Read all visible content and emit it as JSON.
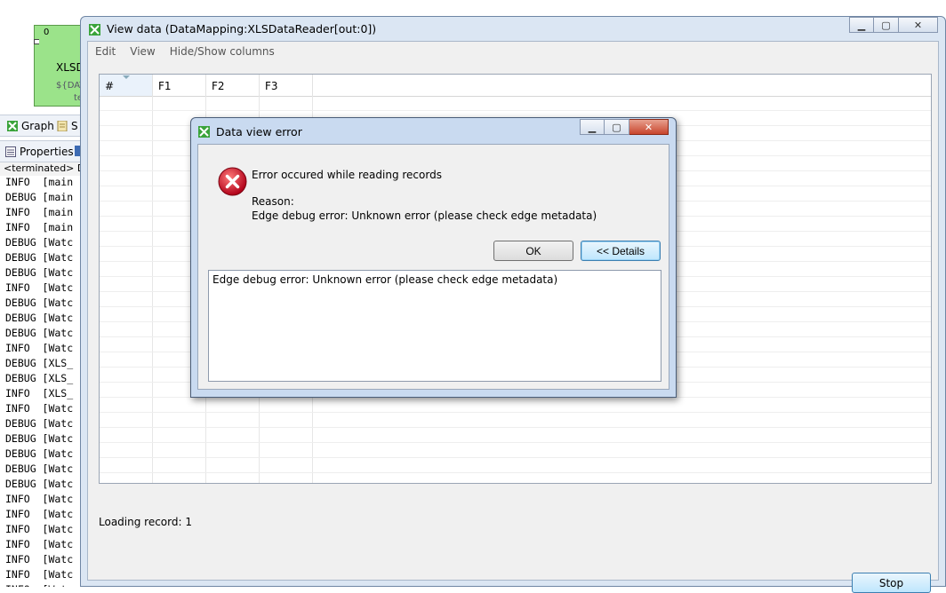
{
  "ide": {
    "node": {
      "count": "0",
      "name": "XLSD",
      "sub1": "${DAT",
      "sub2": "te"
    },
    "tabs_top": [
      {
        "label": "Graph"
      },
      {
        "label": "S"
      }
    ],
    "tabs_bottom": [
      {
        "label": "Properties"
      }
    ],
    "console_header": "<terminated> Da",
    "log_lines": [
      "INFO  [main",
      "DEBUG [main",
      "INFO  [main",
      "INFO  [main",
      "DEBUG [Watc",
      "DEBUG [Watc",
      "DEBUG [Watc",
      "INFO  [Watc",
      "DEBUG [Watc",
      "DEBUG [Watc",
      "DEBUG [Watc",
      "INFO  [Watc",
      "DEBUG [XLS_",
      "DEBUG [XLS_",
      "INFO  [XLS_",
      "INFO  [Watc",
      "DEBUG [Watc",
      "DEBUG [Watc",
      "DEBUG [Watc",
      "DEBUG [Watc",
      "DEBUG [Watc",
      "INFO  [Watc",
      "INFO  [Watc",
      "INFO  [Watc",
      "INFO  [Watc",
      "INFO  [Watc",
      "INFO  [Watc",
      "INFO  [Watc"
    ]
  },
  "view_data": {
    "title": "View data (DataMapping:XLSDataReader[out:0])",
    "menu": [
      "Edit",
      "View",
      "Hide/Show columns"
    ],
    "columns": [
      "#",
      "F1",
      "F2",
      "F3"
    ],
    "status": "Loading record: 1",
    "stop_label": "Stop"
  },
  "dialog": {
    "title": "Data view error",
    "message": "Error occured while reading records",
    "reason_label": "Reason:",
    "reason_text": "Edge debug error: Unknown error (please check edge metadata)",
    "ok_label": "OK",
    "details_label": "<< Details",
    "details_text": "Edge debug error: Unknown error (please check edge metadata)"
  },
  "colors": {
    "node_fill": "#9be38a",
    "window_frame": "#dbe6f3",
    "dialog_frame": "#c9daf0",
    "error_red": "#c8102e"
  }
}
